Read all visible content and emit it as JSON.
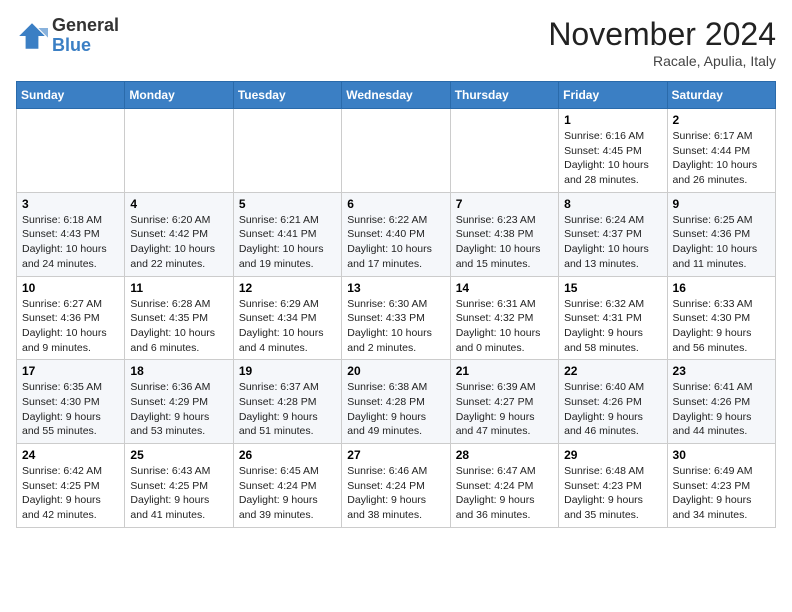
{
  "header": {
    "logo_general": "General",
    "logo_blue": "Blue",
    "month_title": "November 2024",
    "subtitle": "Racale, Apulia, Italy"
  },
  "weekdays": [
    "Sunday",
    "Monday",
    "Tuesday",
    "Wednesday",
    "Thursday",
    "Friday",
    "Saturday"
  ],
  "weeks": [
    [
      {
        "day": "",
        "info": ""
      },
      {
        "day": "",
        "info": ""
      },
      {
        "day": "",
        "info": ""
      },
      {
        "day": "",
        "info": ""
      },
      {
        "day": "",
        "info": ""
      },
      {
        "day": "1",
        "info": "Sunrise: 6:16 AM\nSunset: 4:45 PM\nDaylight: 10 hours\nand 28 minutes."
      },
      {
        "day": "2",
        "info": "Sunrise: 6:17 AM\nSunset: 4:44 PM\nDaylight: 10 hours\nand 26 minutes."
      }
    ],
    [
      {
        "day": "3",
        "info": "Sunrise: 6:18 AM\nSunset: 4:43 PM\nDaylight: 10 hours\nand 24 minutes."
      },
      {
        "day": "4",
        "info": "Sunrise: 6:20 AM\nSunset: 4:42 PM\nDaylight: 10 hours\nand 22 minutes."
      },
      {
        "day": "5",
        "info": "Sunrise: 6:21 AM\nSunset: 4:41 PM\nDaylight: 10 hours\nand 19 minutes."
      },
      {
        "day": "6",
        "info": "Sunrise: 6:22 AM\nSunset: 4:40 PM\nDaylight: 10 hours\nand 17 minutes."
      },
      {
        "day": "7",
        "info": "Sunrise: 6:23 AM\nSunset: 4:38 PM\nDaylight: 10 hours\nand 15 minutes."
      },
      {
        "day": "8",
        "info": "Sunrise: 6:24 AM\nSunset: 4:37 PM\nDaylight: 10 hours\nand 13 minutes."
      },
      {
        "day": "9",
        "info": "Sunrise: 6:25 AM\nSunset: 4:36 PM\nDaylight: 10 hours\nand 11 minutes."
      }
    ],
    [
      {
        "day": "10",
        "info": "Sunrise: 6:27 AM\nSunset: 4:36 PM\nDaylight: 10 hours\nand 9 minutes."
      },
      {
        "day": "11",
        "info": "Sunrise: 6:28 AM\nSunset: 4:35 PM\nDaylight: 10 hours\nand 6 minutes."
      },
      {
        "day": "12",
        "info": "Sunrise: 6:29 AM\nSunset: 4:34 PM\nDaylight: 10 hours\nand 4 minutes."
      },
      {
        "day": "13",
        "info": "Sunrise: 6:30 AM\nSunset: 4:33 PM\nDaylight: 10 hours\nand 2 minutes."
      },
      {
        "day": "14",
        "info": "Sunrise: 6:31 AM\nSunset: 4:32 PM\nDaylight: 10 hours\nand 0 minutes."
      },
      {
        "day": "15",
        "info": "Sunrise: 6:32 AM\nSunset: 4:31 PM\nDaylight: 9 hours\nand 58 minutes."
      },
      {
        "day": "16",
        "info": "Sunrise: 6:33 AM\nSunset: 4:30 PM\nDaylight: 9 hours\nand 56 minutes."
      }
    ],
    [
      {
        "day": "17",
        "info": "Sunrise: 6:35 AM\nSunset: 4:30 PM\nDaylight: 9 hours\nand 55 minutes."
      },
      {
        "day": "18",
        "info": "Sunrise: 6:36 AM\nSunset: 4:29 PM\nDaylight: 9 hours\nand 53 minutes."
      },
      {
        "day": "19",
        "info": "Sunrise: 6:37 AM\nSunset: 4:28 PM\nDaylight: 9 hours\nand 51 minutes."
      },
      {
        "day": "20",
        "info": "Sunrise: 6:38 AM\nSunset: 4:28 PM\nDaylight: 9 hours\nand 49 minutes."
      },
      {
        "day": "21",
        "info": "Sunrise: 6:39 AM\nSunset: 4:27 PM\nDaylight: 9 hours\nand 47 minutes."
      },
      {
        "day": "22",
        "info": "Sunrise: 6:40 AM\nSunset: 4:26 PM\nDaylight: 9 hours\nand 46 minutes."
      },
      {
        "day": "23",
        "info": "Sunrise: 6:41 AM\nSunset: 4:26 PM\nDaylight: 9 hours\nand 44 minutes."
      }
    ],
    [
      {
        "day": "24",
        "info": "Sunrise: 6:42 AM\nSunset: 4:25 PM\nDaylight: 9 hours\nand 42 minutes."
      },
      {
        "day": "25",
        "info": "Sunrise: 6:43 AM\nSunset: 4:25 PM\nDaylight: 9 hours\nand 41 minutes."
      },
      {
        "day": "26",
        "info": "Sunrise: 6:45 AM\nSunset: 4:24 PM\nDaylight: 9 hours\nand 39 minutes."
      },
      {
        "day": "27",
        "info": "Sunrise: 6:46 AM\nSunset: 4:24 PM\nDaylight: 9 hours\nand 38 minutes."
      },
      {
        "day": "28",
        "info": "Sunrise: 6:47 AM\nSunset: 4:24 PM\nDaylight: 9 hours\nand 36 minutes."
      },
      {
        "day": "29",
        "info": "Sunrise: 6:48 AM\nSunset: 4:23 PM\nDaylight: 9 hours\nand 35 minutes."
      },
      {
        "day": "30",
        "info": "Sunrise: 6:49 AM\nSunset: 4:23 PM\nDaylight: 9 hours\nand 34 minutes."
      }
    ]
  ]
}
